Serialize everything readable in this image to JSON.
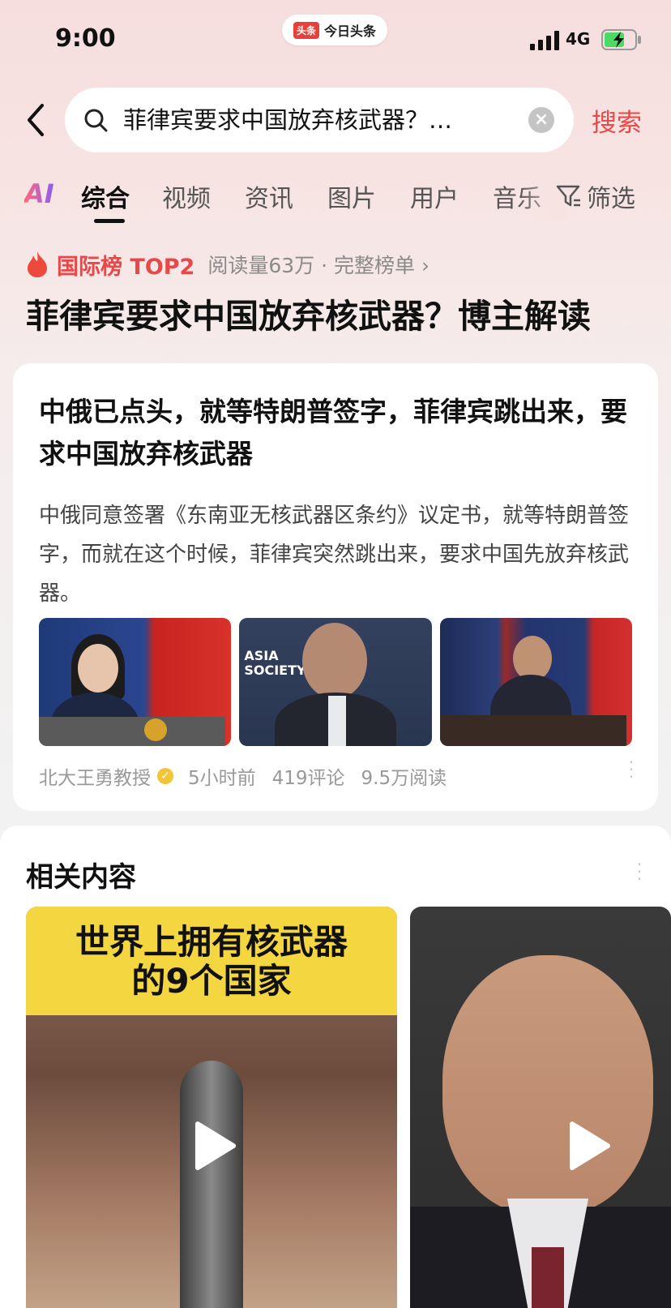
{
  "status_bar": {
    "time": "9:00",
    "app_logo": "头条",
    "app_name": "今日头条",
    "network": "4G"
  },
  "search": {
    "query": "菲律宾要求中国放弃核武器？…",
    "search_button": "搜索"
  },
  "tabs": {
    "ai": "AI",
    "items": [
      "综合",
      "视频",
      "资讯",
      "图片",
      "用户",
      "音乐"
    ],
    "active": "综合",
    "filter": "筛选"
  },
  "hot_list": {
    "label": "国际榜 TOP2",
    "meta": "阅读量63万 · 完整榜单 ›",
    "title": "菲律宾要求中国放弃核武器？博主解读",
    "accent_color": "#e84848"
  },
  "article": {
    "title": "中俄已点头，就等特朗普签字，菲律宾跳出来，要求中国放弃核武器",
    "summary": "中俄同意签署《东南亚无核武器区条约》议定书，就等特朗普签字，而就在这个时候，菲律宾突然跳出来，要求中国先放弃核武器。",
    "image2_text": "ASIA SOCIETY",
    "author": "北大王勇教授",
    "time": "5小时前",
    "comments": "419评论",
    "reads": "9.5万阅读"
  },
  "related": {
    "title": "相关内容",
    "video1_line1": "世界上拥有核武器",
    "video1_line2": "的9个国家"
  },
  "icons": {
    "back": "chevron-left-icon",
    "search": "search-icon",
    "clear": "clear-icon",
    "filter": "filter-icon",
    "flame": "flame-icon",
    "verified": "verified-icon",
    "more": "more-vertical-icon",
    "play": "play-icon"
  }
}
